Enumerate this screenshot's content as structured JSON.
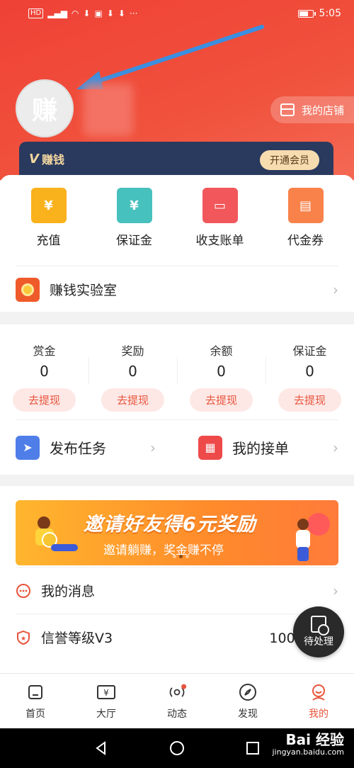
{
  "status_bar": {
    "carrier_chip": "HD",
    "signal": "⁴⁶",
    "time": "5:05"
  },
  "profile": {
    "avatar_text": "赚",
    "shop_label": "我的店铺"
  },
  "vip": {
    "badge": "V",
    "title": "赚钱",
    "button": "开通会员"
  },
  "quick_actions": [
    {
      "label": "充值",
      "glyph": "¥",
      "color": "#f9b11c"
    },
    {
      "label": "保证金",
      "glyph": "¥",
      "color": "#47c1bd"
    },
    {
      "label": "收支账单",
      "glyph": "▭",
      "color": "#f1575b"
    },
    {
      "label": "代金券",
      "glyph": "▤",
      "color": "#f8824a"
    }
  ],
  "lab": {
    "label": "赚钱实验室"
  },
  "balances": [
    {
      "label": "赏金",
      "value": "0",
      "button": "去提现"
    },
    {
      "label": "奖励",
      "value": "0",
      "button": "去提现"
    },
    {
      "label": "余额",
      "value": "0",
      "button": "去提现"
    },
    {
      "label": "保证金",
      "value": "0",
      "button": "去提现"
    }
  ],
  "tasks": {
    "publish": "发布任务",
    "my_orders": "我的接单"
  },
  "banner": {
    "title": "邀请好友得6元奖励",
    "subtitle": "邀请躺赚，奖金赚不停"
  },
  "menu": {
    "messages": "我的消息",
    "credit_label": "信誉等级V3",
    "credit_value": "1000.00分"
  },
  "floating": {
    "label": "待处理"
  },
  "tabs": [
    {
      "label": "首页",
      "icon": "home-icon"
    },
    {
      "label": "大厅",
      "icon": "hall-icon"
    },
    {
      "label": "动态",
      "icon": "activity-icon"
    },
    {
      "label": "发现",
      "icon": "compass-icon"
    },
    {
      "label": "我的",
      "icon": "profile-icon"
    }
  ],
  "watermark": {
    "brand": "Bai 经验",
    "url": "jingyan.baidu.com"
  },
  "colors": {
    "brand_red": "#ef4136",
    "vip_navy": "#2a3a5e",
    "accent": "#e8553c"
  }
}
